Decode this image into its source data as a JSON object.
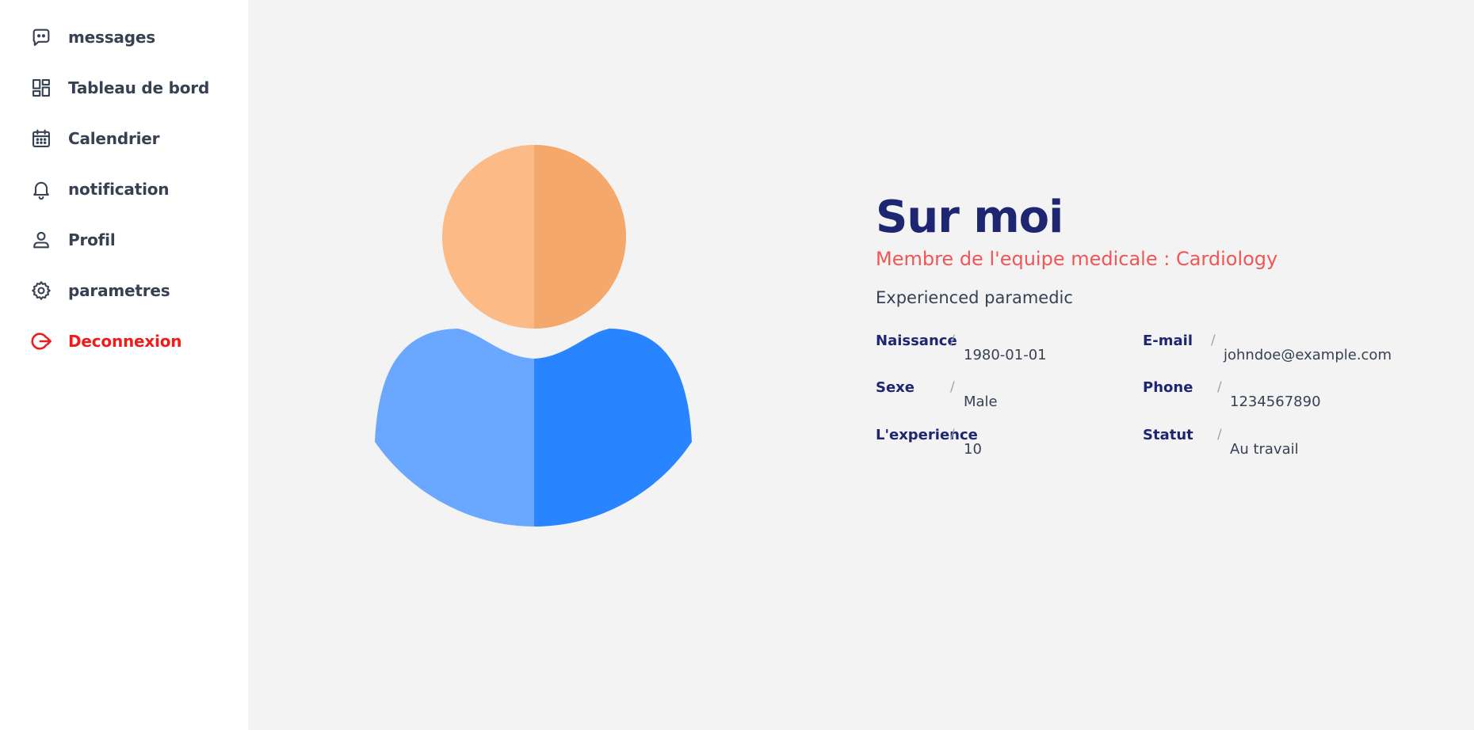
{
  "sidebar": {
    "items": [
      {
        "label": "messages",
        "icon": "message-icon"
      },
      {
        "label": "Tableau de bord",
        "icon": "dashboard-icon"
      },
      {
        "label": "Calendrier",
        "icon": "calendar-icon"
      },
      {
        "label": "notification",
        "icon": "bell-icon"
      },
      {
        "label": "Profil",
        "icon": "user-icon"
      },
      {
        "label": "parametres",
        "icon": "gear-icon"
      },
      {
        "label": "Deconnexion",
        "icon": "logout-icon",
        "color": "#ef1c1c"
      }
    ]
  },
  "profile": {
    "title": "Sur moi",
    "subtitle": "Membre de l'equipe medicale : Cardiology",
    "description": "Experienced paramedic",
    "separator": "/",
    "fields": {
      "birth": {
        "label": "Naissance",
        "value": "1980-01-01"
      },
      "email": {
        "label": "E-mail",
        "value": "johndoe@example.com"
      },
      "gender": {
        "label": "Sexe",
        "value": "Male"
      },
      "phone": {
        "label": "Phone",
        "value": "1234567890"
      },
      "experience": {
        "label": "L'experience",
        "value": "10"
      },
      "status": {
        "label": "Statut",
        "value": "Au travail"
      }
    }
  },
  "colors": {
    "title": "#1e2672",
    "subtitle": "#f05656",
    "logout": "#ef1c1c",
    "background": "#f3f3f4",
    "avatar_head_light": "#fcba86",
    "avatar_head_dark": "#f4a86c",
    "avatar_body_light": "#6aa8ff",
    "avatar_body_dark": "#2884ff"
  }
}
